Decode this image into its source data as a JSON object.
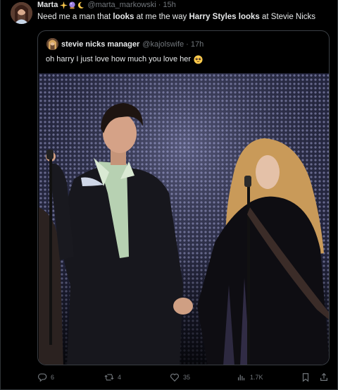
{
  "tweet": {
    "author_name": "Marta",
    "author_handle": "@marta_markowski",
    "separator": "·",
    "time": "15h",
    "text_parts": {
      "p1": "Need me a man that ",
      "b1": "looks",
      "p2": " at me the way ",
      "b2": "Harry Styles looks",
      "p3": " at Stevie Nicks"
    },
    "icons": [
      "sparkles-emoji",
      "crystal-ball-emoji",
      "moon-emoji"
    ]
  },
  "quoted_tweet": {
    "author_name": "stevie nicks manager",
    "author_handle": "@kajolswife",
    "separator": "·",
    "time": "17h",
    "text": "oh harry I just love how much you love her",
    "emoji": "pleading-face-emoji"
  },
  "actions": {
    "replies": "6",
    "reposts": "4",
    "likes": "35",
    "views": "1.7K"
  },
  "colors": {
    "background": "#000000",
    "text": "#e7e9ea",
    "muted": "#71767b",
    "border": "#2f3336"
  }
}
